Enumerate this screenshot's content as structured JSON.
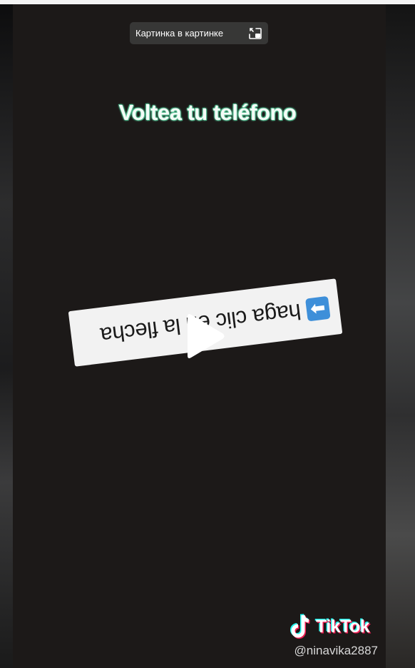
{
  "pip": {
    "label": "Картинка в картинке",
    "icon": "picture-in-picture-icon"
  },
  "video": {
    "headline": "Voltea tu teléfono",
    "sticker_text": "haga clic en la flecha",
    "sticker_arrow_glyph": "➡",
    "play_icon": "play-icon"
  },
  "watermark": {
    "brand": "TikTok",
    "handle": "@ninavika2887",
    "logo_icon": "tiktok-note-icon"
  },
  "colors": {
    "headline_outline": "#5fcf9f",
    "arrow_badge": "#3e8fd9",
    "sticker_bg": "#f2f2f2",
    "video_bg": "#1c1918"
  }
}
